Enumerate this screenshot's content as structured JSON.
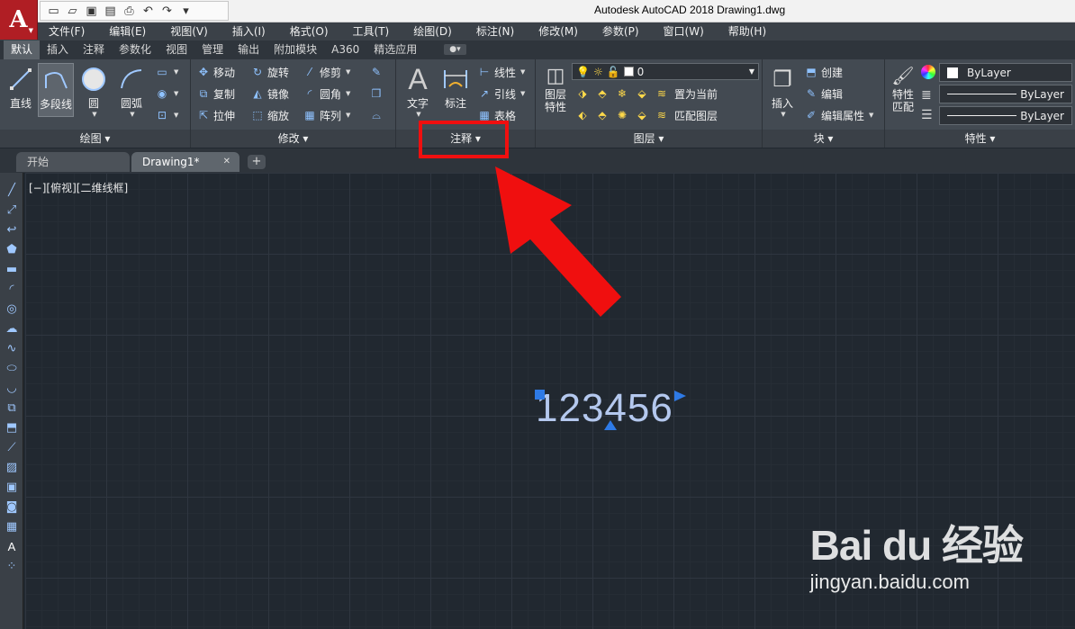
{
  "app": {
    "logo_letter": "A",
    "title": "Autodesk AutoCAD 2018    Drawing1.dwg"
  },
  "quick_access": [
    "new-icon",
    "open-icon",
    "save-icon",
    "saveas-icon",
    "print-icon",
    "undo-icon",
    "redo-icon"
  ],
  "menu": [
    "文件(F)",
    "编辑(E)",
    "视图(V)",
    "插入(I)",
    "格式(O)",
    "工具(T)",
    "绘图(D)",
    "标注(N)",
    "修改(M)",
    "参数(P)",
    "窗口(W)",
    "帮助(H)"
  ],
  "ribbon_tabs": [
    "默认",
    "插入",
    "注释",
    "参数化",
    "视图",
    "管理",
    "输出",
    "附加模块",
    "A360",
    "精选应用"
  ],
  "active_tab": "默认",
  "draw_panel": {
    "footer": "绘图",
    "tools": [
      "直线",
      "多段线",
      "圆",
      "圆弧"
    ]
  },
  "modify_panel": {
    "footer": "修改",
    "row1": [
      "移动",
      "旋转",
      "修剪"
    ],
    "row2": [
      "复制",
      "镜像",
      "圆角"
    ],
    "row3": [
      "拉伸",
      "缩放",
      "阵列"
    ]
  },
  "annotation_panel": {
    "footer": "注释",
    "big": [
      "文字",
      "标注"
    ],
    "small": [
      "线性",
      "引线",
      "表格"
    ]
  },
  "layers_panel": {
    "footer": "图层",
    "big": "图层\n特性",
    "current_layer": "0",
    "buttons": [
      "置为当前",
      "匹配图层"
    ]
  },
  "block_panel": {
    "footer": "块",
    "big": "插入",
    "buttons": [
      "创建",
      "编辑",
      "编辑属性"
    ]
  },
  "properties_panel": {
    "footer": "特性",
    "big": "特性\n匹配",
    "color": "ByLayer",
    "linetype": "ByLayer",
    "lineweight": "ByLayer"
  },
  "file_tabs": {
    "start": "开始",
    "current": "Drawing1*",
    "add": "+"
  },
  "viewport_label": "[−][俯视][二维线框]",
  "text_object": "123456",
  "watermark": {
    "brand": "Bai du 经验",
    "site": "jingyan.baidu.com"
  },
  "colors": {
    "accent": "#b01e24",
    "highlight": "#f00f0f",
    "grip": "#2e7ae6"
  }
}
